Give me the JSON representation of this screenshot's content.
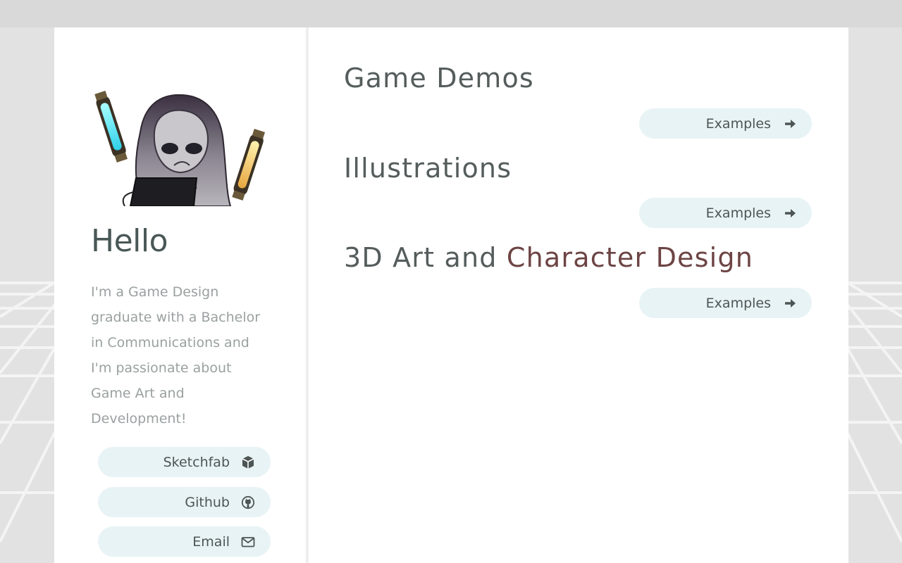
{
  "profile": {
    "greeting": "Hello",
    "bio_lines": [
      "I'm a Game Design",
      "graduate with a Bachelor",
      "in Communications and",
      "I'm passionate about",
      "Game Art and",
      "Development!"
    ],
    "avatar_icon": "hooded-character-avatar"
  },
  "social_links": [
    {
      "label": "Sketchfab",
      "icon": "cube-icon"
    },
    {
      "label": "Github",
      "icon": "github-icon"
    },
    {
      "label": "Email",
      "icon": "envelope-icon"
    }
  ],
  "sections": [
    {
      "title": "Game Demos",
      "title_highlight": "",
      "button_label": "Examples",
      "icon": "arrow-right-icon"
    },
    {
      "title": "Illustrations",
      "title_highlight": "",
      "button_label": "Examples",
      "icon": "arrow-right-icon"
    },
    {
      "title": "3D Art and ",
      "title_highlight": "Character Design",
      "button_label": "Examples",
      "icon": "arrow-right-icon"
    }
  ],
  "colors": {
    "page_bg": "#e2e2e2",
    "panel_bg": "#ffffff",
    "button_bg": "#e8f3f5",
    "title_text": "#555c5c",
    "highlight_text": "#6d4444",
    "bio_text": "#9aa0a0"
  }
}
